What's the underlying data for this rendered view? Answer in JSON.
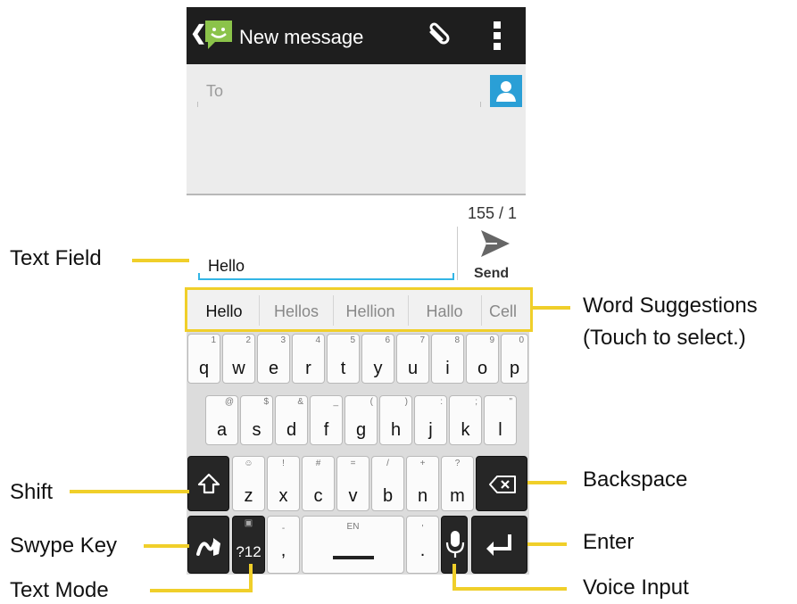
{
  "header": {
    "title": "New message"
  },
  "recipient": {
    "placeholder": "To"
  },
  "composer": {
    "counter": "155 / 1",
    "text": "Hello",
    "send_label": "Send"
  },
  "suggestions": [
    "Hello",
    "Hellos",
    "Hellion",
    "Hallo",
    "Cell"
  ],
  "keyboard": {
    "row1": [
      {
        "key": "q",
        "sub": "1"
      },
      {
        "key": "w",
        "sub": "2"
      },
      {
        "key": "e",
        "sub": "3"
      },
      {
        "key": "r",
        "sub": "4"
      },
      {
        "key": "t",
        "sub": "5"
      },
      {
        "key": "y",
        "sub": "6"
      },
      {
        "key": "u",
        "sub": "7"
      },
      {
        "key": "i",
        "sub": "8"
      },
      {
        "key": "o",
        "sub": "9"
      },
      {
        "key": "p",
        "sub": "0"
      }
    ],
    "row2": [
      {
        "key": "a",
        "sub": "@"
      },
      {
        "key": "s",
        "sub": "$"
      },
      {
        "key": "d",
        "sub": "&"
      },
      {
        "key": "f",
        "sub": "_"
      },
      {
        "key": "g",
        "sub": "("
      },
      {
        "key": "h",
        "sub": ")"
      },
      {
        "key": "j",
        "sub": ":"
      },
      {
        "key": "k",
        "sub": ";"
      },
      {
        "key": "l",
        "sub": "\""
      }
    ],
    "row3": [
      {
        "key": "z",
        "sub": "☺"
      },
      {
        "key": "x",
        "sub": "!"
      },
      {
        "key": "c",
        "sub": "#"
      },
      {
        "key": "v",
        "sub": "="
      },
      {
        "key": "b",
        "sub": "/"
      },
      {
        "key": "n",
        "sub": "+"
      },
      {
        "key": "m",
        "sub": "?"
      }
    ],
    "text_mode_label": "?12",
    "comma": ",",
    "comma_sub": "-",
    "space_lang": "EN",
    "period": ".",
    "period_sub": "'"
  },
  "annotations": {
    "text_field": "Text Field",
    "word_suggestions": "Word Suggestions",
    "word_suggestions_hint": "(Touch to select.)",
    "shift": "Shift",
    "backspace": "Backspace",
    "swype_key": "Swype Key",
    "enter": "Enter",
    "text_mode": "Text Mode",
    "voice_input": "Voice Input"
  },
  "colors": {
    "accent": "#33b5e5",
    "callout": "#f0cf2a",
    "action_bar": "#1e1e1e",
    "contact": "#2a9fd6",
    "dark_key": "#262626"
  },
  "icons": [
    "back-chevron-icon",
    "messaging-app-icon",
    "paperclip-icon",
    "overflow-menu-icon",
    "contact-picker-icon",
    "send-icon",
    "shift-icon",
    "backspace-icon",
    "swype-icon",
    "microphone-icon",
    "enter-icon"
  ]
}
